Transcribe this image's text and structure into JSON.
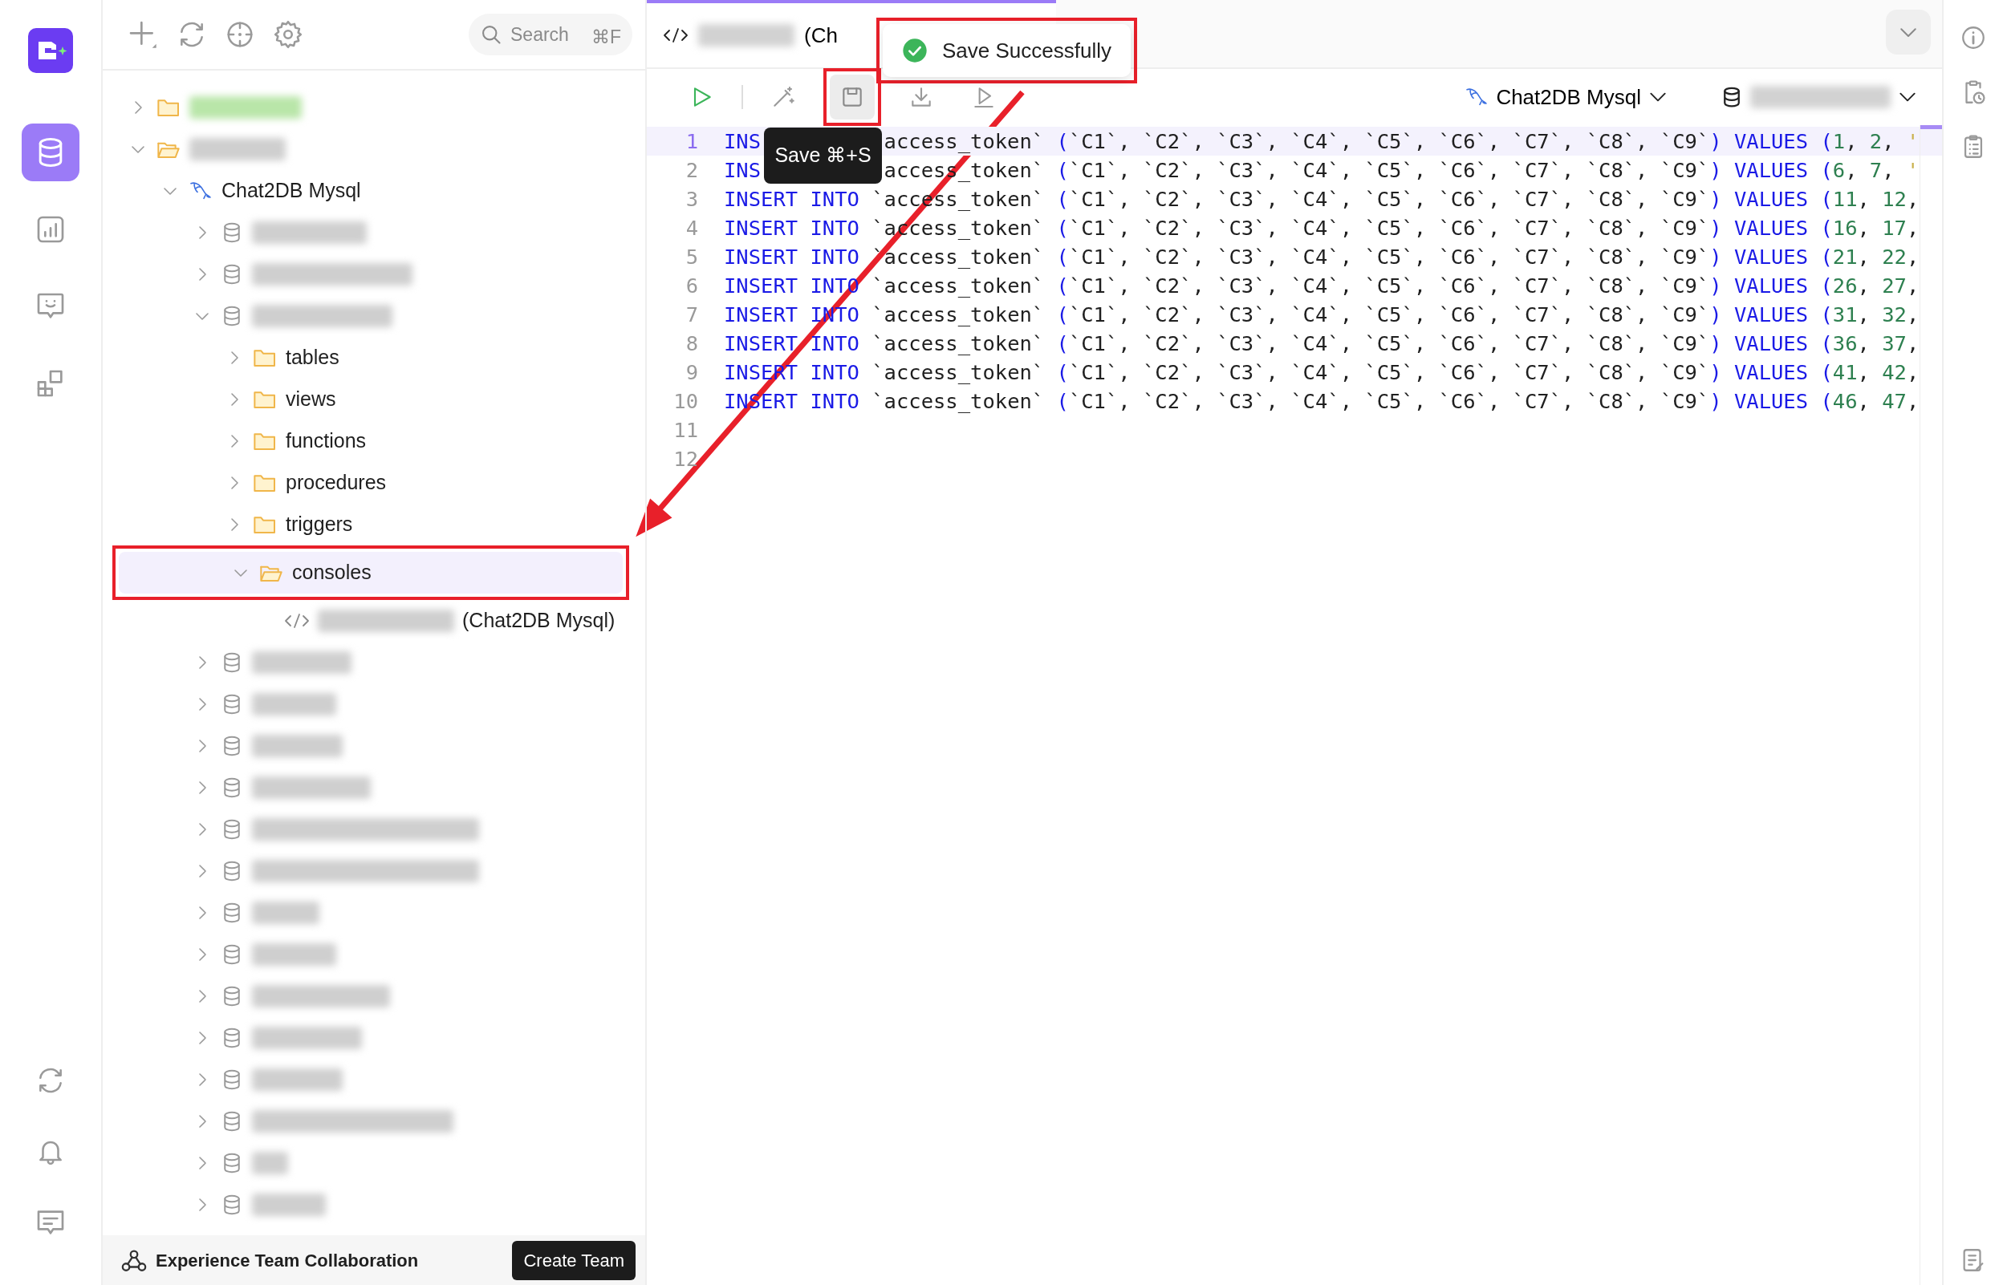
{
  "nav_rail": [
    {
      "selected": true
    },
    {
      "selected": false
    },
    {
      "selected": false
    },
    {
      "selected": false
    }
  ],
  "explorer": {
    "search": {
      "placeholder": "Search",
      "shortcut": "⌘F"
    },
    "tree": [
      {
        "kind": "folder",
        "expanded": false,
        "selected": false,
        "color": "#b9e6a9"
      },
      {
        "kind": "folder",
        "expanded": true,
        "selected": false,
        "children": [
          {
            "kind": "connection",
            "label": "Chat2DB Mysql",
            "expanded": true,
            "selected": false,
            "children": [
              {
                "kind": "database",
                "expanded": false,
                "selected": false
              },
              {
                "kind": "database",
                "expanded": false,
                "selected": false
              },
              {
                "kind": "database",
                "expanded": true,
                "selected": false,
                "children": [
                  {
                    "kind": "folder",
                    "label": "tables",
                    "expanded": false,
                    "selected": false,
                    "highlighted": false
                  },
                  {
                    "kind": "folder",
                    "label": "views",
                    "expanded": false,
                    "selected": false,
                    "highlighted": false
                  },
                  {
                    "kind": "folder",
                    "label": "functions",
                    "expanded": false,
                    "selected": false,
                    "highlighted": false
                  },
                  {
                    "kind": "folder",
                    "label": "procedures",
                    "expanded": false,
                    "selected": false,
                    "highlighted": false
                  },
                  {
                    "kind": "folder",
                    "label": "triggers",
                    "expanded": false,
                    "selected": false,
                    "highlighted": false
                  },
                  {
                    "kind": "folder",
                    "label": "consoles",
                    "expanded": true,
                    "selected": true,
                    "highlighted": true,
                    "children": [
                      {
                        "kind": "console",
                        "label": "(Chat2DB Mysql)",
                        "selected": false
                      }
                    ]
                  }
                ]
              },
              {
                "kind": "database",
                "expanded": false,
                "selected": false
              },
              {
                "kind": "database",
                "expanded": false,
                "selected": false
              },
              {
                "kind": "database",
                "expanded": false,
                "selected": false
              },
              {
                "kind": "database",
                "expanded": false,
                "selected": false
              },
              {
                "kind": "database",
                "expanded": false,
                "selected": false
              },
              {
                "kind": "database",
                "expanded": false,
                "selected": false
              },
              {
                "kind": "database",
                "expanded": false,
                "selected": false
              },
              {
                "kind": "database",
                "expanded": false,
                "selected": false
              },
              {
                "kind": "database",
                "expanded": false,
                "selected": false
              },
              {
                "kind": "database",
                "expanded": false,
                "selected": false
              },
              {
                "kind": "database",
                "expanded": false,
                "selected": false
              },
              {
                "kind": "database",
                "expanded": false,
                "selected": false
              },
              {
                "kind": "database",
                "expanded": false,
                "selected": false
              },
              {
                "kind": "database",
                "expanded": false,
                "selected": false
              }
            ]
          }
        ]
      }
    ],
    "footer": {
      "text": "Experience Team Collaboration",
      "button": "Create Team"
    }
  },
  "editor": {
    "tabs": [
      {
        "title": "(Ch",
        "selected": true
      }
    ],
    "toolbar": [
      {
        "kind": "run",
        "hovered": false,
        "highlighted": false
      },
      {
        "kind": "separator"
      },
      {
        "kind": "optimize",
        "hovered": false,
        "highlighted": false
      },
      {
        "kind": "save",
        "hovered": true,
        "highlighted": true
      },
      {
        "kind": "export",
        "hovered": false,
        "highlighted": false
      },
      {
        "kind": "explain",
        "hovered": false,
        "highlighted": false
      }
    ],
    "connection": "Chat2DB Mysql",
    "tooltip": "Save ⌘+S",
    "toast": {
      "text": "Save Successfully",
      "highlighted": true
    },
    "lines": [
      {
        "number": "1",
        "active": true,
        "covered": true,
        "keyword": "INS",
        "table": "access_token`",
        "columns": "(`C1`, `C2`, `C3`, `C4`, `C5`, `C6`, `C7`, `C8`, `C9`)",
        "values_keyword": "VALUES",
        "values": "(1, 2, '"
      },
      {
        "number": "2",
        "active": false,
        "covered": true,
        "keyword": "INS",
        "table": "access_token`",
        "columns": "(`C1`, `C2`, `C3`, `C4`, `C5`, `C6`, `C7`, `C8`, `C9`)",
        "values_keyword": "VALUES",
        "values": "(6, 7, '"
      },
      {
        "number": "3",
        "active": false,
        "keyword": "INSERT INTO",
        "table": "`access_token`",
        "columns": "(`C1`, `C2`, `C3`, `C4`, `C5`, `C6`, `C7`, `C8`, `C9`)",
        "values_keyword": "VALUES",
        "values": "(11, 12,"
      },
      {
        "number": "4",
        "active": false,
        "keyword": "INSERT INTO",
        "table": "`access_token`",
        "columns": "(`C1`, `C2`, `C3`, `C4`, `C5`, `C6`, `C7`, `C8`, `C9`)",
        "values_keyword": "VALUES",
        "values": "(16, 17,"
      },
      {
        "number": "5",
        "active": false,
        "keyword": "INSERT INTO",
        "table": "`access_token`",
        "columns": "(`C1`, `C2`, `C3`, `C4`, `C5`, `C6`, `C7`, `C8`, `C9`)",
        "values_keyword": "VALUES",
        "values": "(21, 22,"
      },
      {
        "number": "6",
        "active": false,
        "keyword": "INSERT INTO",
        "table": "`access_token`",
        "columns": "(`C1`, `C2`, `C3`, `C4`, `C5`, `C6`, `C7`, `C8`, `C9`)",
        "values_keyword": "VALUES",
        "values": "(26, 27,"
      },
      {
        "number": "7",
        "active": false,
        "keyword": "INSERT INTO",
        "table": "`access_token`",
        "columns": "(`C1`, `C2`, `C3`, `C4`, `C5`, `C6`, `C7`, `C8`, `C9`)",
        "values_keyword": "VALUES",
        "values": "(31, 32,"
      },
      {
        "number": "8",
        "active": false,
        "keyword": "INSERT INTO",
        "table": "`access_token`",
        "columns": "(`C1`, `C2`, `C3`, `C4`, `C5`, `C6`, `C7`, `C8`, `C9`)",
        "values_keyword": "VALUES",
        "values": "(36, 37,"
      },
      {
        "number": "9",
        "active": false,
        "keyword": "INSERT INTO",
        "table": "`access_token`",
        "columns": "(`C1`, `C2`, `C3`, `C4`, `C5`, `C6`, `C7`, `C8`, `C9`)",
        "values_keyword": "VALUES",
        "values": "(41, 42,"
      },
      {
        "number": "10",
        "active": false,
        "keyword": "INSERT INTO",
        "table": "`access_token`",
        "columns": "(`C1`, `C2`, `C3`, `C4`, `C5`, `C6`, `C7`, `C8`, `C9`)",
        "values_keyword": "VALUES",
        "values": "(46, 47,"
      },
      {
        "number": "11",
        "active": false
      },
      {
        "number": "12",
        "active": false
      }
    ]
  },
  "annotation_arrow": true
}
